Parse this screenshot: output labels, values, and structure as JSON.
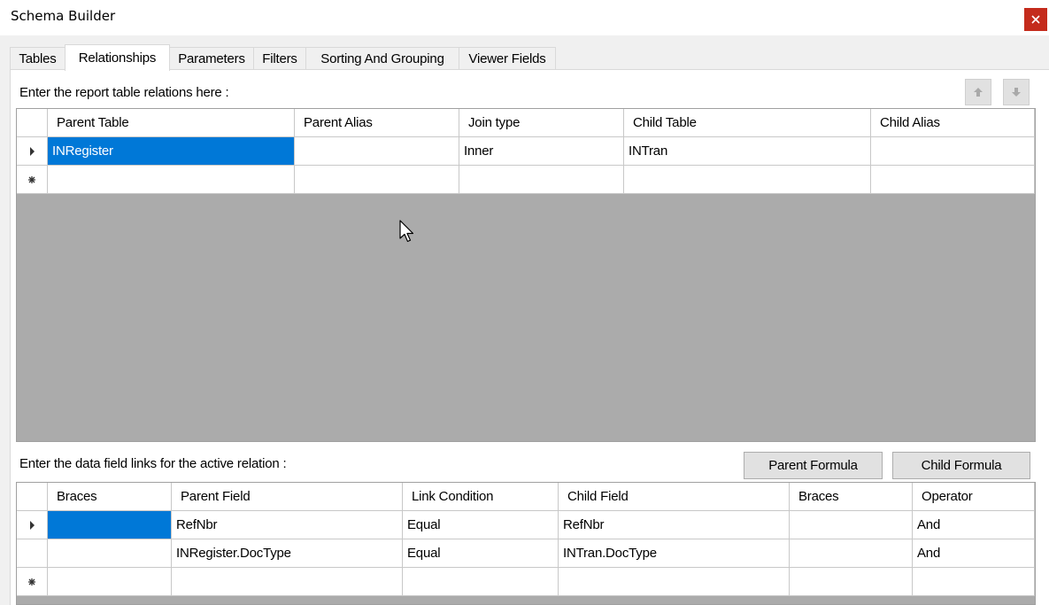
{
  "window": {
    "title": "Schema Builder",
    "close_icon": "close-icon"
  },
  "tabs": [
    {
      "label": "Tables"
    },
    {
      "label": "Relationships",
      "active": true
    },
    {
      "label": "Parameters"
    },
    {
      "label": "Filters"
    },
    {
      "label": "Sorting And Grouping"
    },
    {
      "label": "Viewer Fields"
    }
  ],
  "relations": {
    "caption": "Enter the report table relations here :",
    "move_up_icon": "arrow-up-icon",
    "move_down_icon": "arrow-down-icon",
    "columns": [
      "Parent Table",
      "Parent Alias",
      "Join type",
      "Child Table",
      "Child Alias"
    ],
    "rows": [
      {
        "marker": "current-row-arrow",
        "cells": [
          "INRegister",
          "",
          "Inner",
          "INTran",
          ""
        ]
      }
    ],
    "new_row_marker": "new-row-star"
  },
  "links": {
    "caption": "Enter the data field links for the active relation :",
    "parent_formula_label": "Parent Formula",
    "child_formula_label": "Child Formula",
    "columns": [
      "Braces",
      "Parent Field",
      "Link Condition",
      "Child Field",
      "Braces",
      "Operator"
    ],
    "rows": [
      {
        "marker": "current-row-arrow",
        "cells": [
          "",
          "RefNbr",
          "Equal",
          "RefNbr",
          "",
          "And"
        ]
      },
      {
        "marker": "",
        "cells": [
          "",
          "INRegister.DocType",
          "Equal",
          "INTran.DocType",
          "",
          "And"
        ]
      }
    ],
    "new_row_marker": "new-row-star"
  },
  "colors": {
    "selection": "#0078d7",
    "close": "#c42b1c",
    "grid_empty": "#ababab"
  }
}
